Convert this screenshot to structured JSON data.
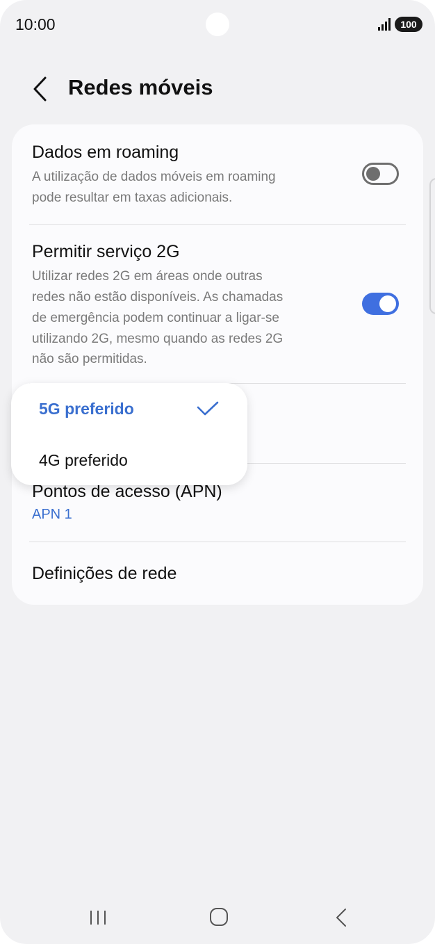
{
  "status_bar": {
    "time": "10:00",
    "battery": "100",
    "icons": [
      "signal-icon",
      "battery-icon"
    ]
  },
  "header": {
    "title": "Redes móveis",
    "back_icon": "chevron-left-icon"
  },
  "settings": {
    "roaming": {
      "title": "Dados em roaming",
      "subtitle_lines": [
        "A utilização de dados móveis em roaming",
        "pode resultar em taxas adicionais."
      ],
      "toggle": "off"
    },
    "allow_2g": {
      "title": "Permitir serviço 2G",
      "subtitle_lines": [
        "Utilizar redes 2G em áreas onde outras",
        "redes não estão disponíveis. As chamadas",
        "de emergência podem continuar a ligar-se",
        "utilizando 2G, mesmo quando as redes 2G",
        "não são permitidas."
      ],
      "toggle": "on"
    },
    "apn": {
      "title": "Pontos de acesso (APN)",
      "value": "APN 1"
    },
    "network_settings": {
      "title": "Definições de rede"
    }
  },
  "network_mode_popup": {
    "options": [
      {
        "label": "5G preferido",
        "selected": true
      },
      {
        "label": "4G preferido",
        "selected": false
      }
    ]
  },
  "nav_bar": {
    "icons": [
      "recents-icon",
      "home-icon",
      "back-icon"
    ]
  },
  "colors": {
    "accent": "#3a6fcf",
    "toggle_on": "#3f6fe0",
    "background": "#f1f1f3",
    "card": "#fbfbfd"
  }
}
